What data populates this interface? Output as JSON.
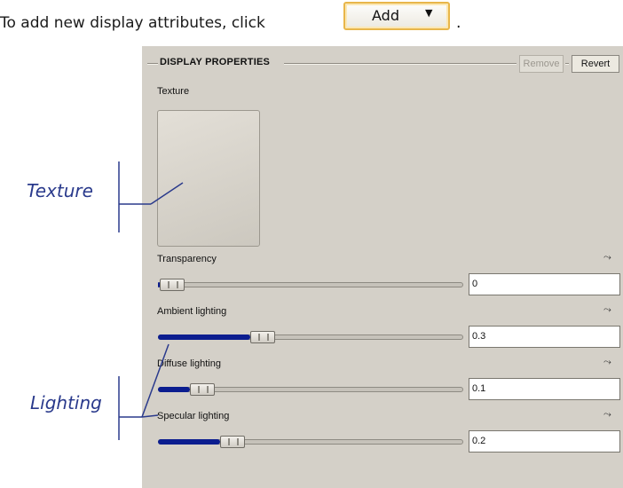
{
  "instruction": {
    "text": "To add new display attributes, click",
    "add_button_label": "Add",
    "period": "."
  },
  "panel": {
    "section_title": "DISPLAY PROPERTIES",
    "remove_label": "Remove",
    "revert_label": "Revert",
    "texture_label": "Texture",
    "sliders": [
      {
        "label": "Transparency",
        "value": "0",
        "level": 0.0
      },
      {
        "label": "Ambient lighting",
        "value": "0.3",
        "level": 0.3
      },
      {
        "label": "Diffuse lighting",
        "value": "0.1",
        "level": 0.1
      },
      {
        "label": "Specular lighting",
        "value": "0.2",
        "level": 0.2
      }
    ]
  },
  "callouts": {
    "texture": "Texture",
    "lighting": "Lighting"
  },
  "colors": {
    "accent_fill": "#0b1d8f",
    "callout": "#2a3a8c",
    "button_border": "#e8b64a",
    "panel_bg": "#d4d0c8"
  },
  "icons": {
    "dropdown": "chevron-down-icon",
    "graph": "graph-curve-icon"
  }
}
